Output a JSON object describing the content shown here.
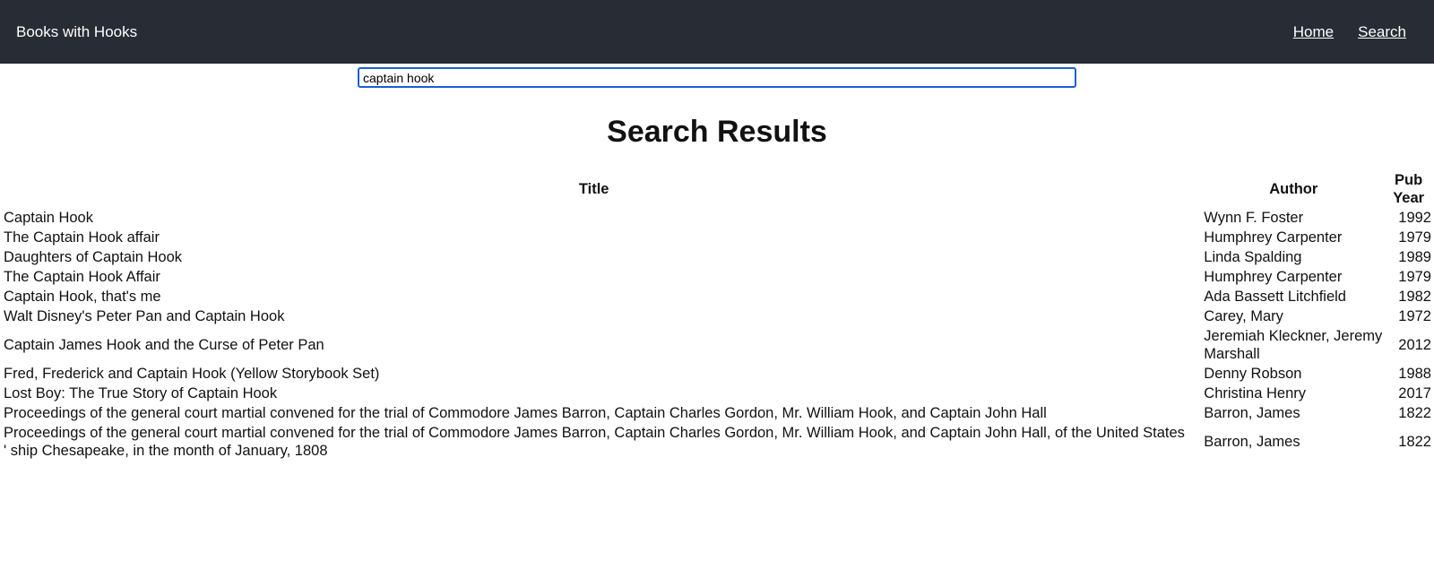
{
  "navbar": {
    "brand": "Books with Hooks",
    "links": [
      "Home",
      "Search"
    ]
  },
  "search": {
    "value": "captain hook",
    "placeholder": ""
  },
  "results": {
    "heading": "Search Results",
    "columns": [
      "Title",
      "Author",
      "Pub Year"
    ],
    "rows": [
      {
        "title": "Captain Hook",
        "author": "Wynn F. Foster",
        "year": "1992"
      },
      {
        "title": "The Captain Hook affair",
        "author": "Humphrey Carpenter",
        "year": "1979"
      },
      {
        "title": "Daughters of Captain Hook",
        "author": "Linda Spalding",
        "year": "1989"
      },
      {
        "title": "The Captain Hook Affair",
        "author": "Humphrey Carpenter",
        "year": "1979"
      },
      {
        "title": "Captain Hook, that's me",
        "author": "Ada Bassett Litchfield",
        "year": "1982"
      },
      {
        "title": "Walt Disney's Peter Pan and Captain Hook",
        "author": "Carey, Mary",
        "year": "1972"
      },
      {
        "title": "Captain James Hook and the Curse of Peter Pan",
        "author": "Jeremiah Kleckner, Jeremy Marshall",
        "year": "2012"
      },
      {
        "title": "Fred, Frederick and Captain Hook (Yellow Storybook Set)",
        "author": "Denny Robson",
        "year": "1988"
      },
      {
        "title": "Lost Boy: The True Story of Captain Hook",
        "author": "Christina Henry",
        "year": "2017"
      },
      {
        "title": "Proceedings of the general court martial convened for the trial of Commodore James Barron, Captain Charles Gordon, Mr. William Hook, and Captain John Hall",
        "author": "Barron, James",
        "year": "1822"
      },
      {
        "title": "Proceedings of the general court martial convened for the trial of Commodore James Barron, Captain Charles Gordon, Mr. William Hook, and Captain John Hall, of the United States ' ship Chesapeake, in the month of January, 1808",
        "author": "Barron, James",
        "year": "1822"
      }
    ]
  }
}
